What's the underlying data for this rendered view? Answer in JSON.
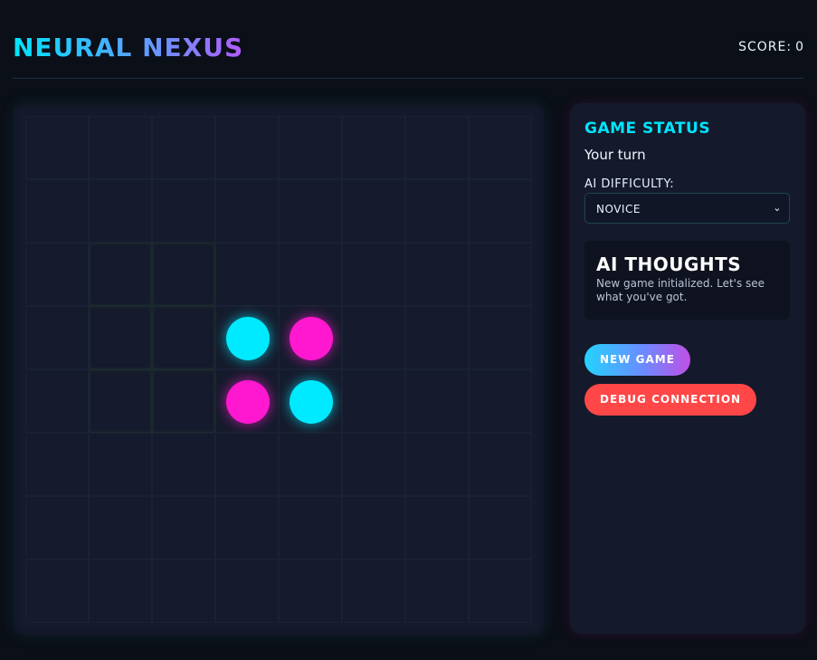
{
  "header": {
    "title": "NEURAL NEXUS",
    "score_label": "SCORE:",
    "score_value": "0"
  },
  "board": {
    "size": 8,
    "discs": [
      {
        "row": 3,
        "col": 3,
        "color": "cyan"
      },
      {
        "row": 3,
        "col": 4,
        "color": "magenta"
      },
      {
        "row": 4,
        "col": 3,
        "color": "magenta"
      },
      {
        "row": 4,
        "col": 4,
        "color": "cyan"
      }
    ],
    "hint_cells": [
      {
        "row": 2,
        "col": 1
      },
      {
        "row": 2,
        "col": 2
      },
      {
        "row": 3,
        "col": 1
      },
      {
        "row": 3,
        "col": 2
      },
      {
        "row": 4,
        "col": 1
      },
      {
        "row": 4,
        "col": 2
      }
    ]
  },
  "status": {
    "heading": "GAME STATUS",
    "text": "Your turn"
  },
  "difficulty": {
    "label": "AI DIFFICULTY:",
    "selected": "NOVICE"
  },
  "thoughts": {
    "heading": "AI THOUGHTS",
    "text": "New game initialized. Let's see what you've got."
  },
  "buttons": {
    "new_game": "NEW GAME",
    "debug": "DEBUG CONNECTION"
  },
  "colors": {
    "cyan": "#00eaff",
    "magenta": "#ff18d0",
    "accent": "#00e5ff",
    "danger": "#ff4747"
  }
}
